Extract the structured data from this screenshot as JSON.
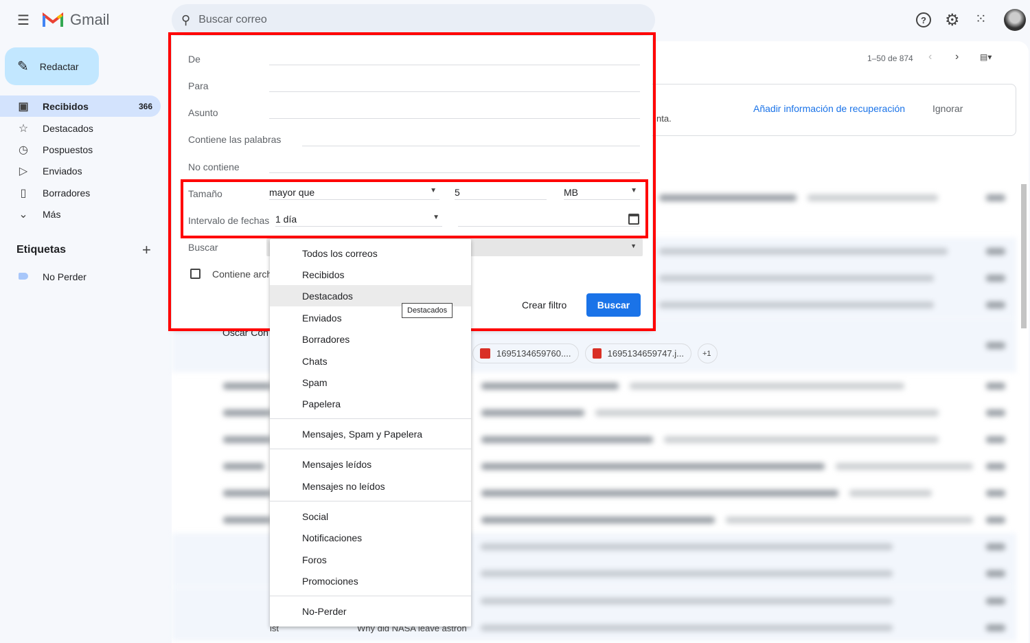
{
  "header": {
    "app_name": "Gmail",
    "search_placeholder": "Buscar correo"
  },
  "sidebar": {
    "compose": "Redactar",
    "items": [
      {
        "label": "Recibidos",
        "count": "366",
        "icon": "inbox-icon"
      },
      {
        "label": "Destacados",
        "icon": "star-icon"
      },
      {
        "label": "Pospuestos",
        "icon": "clock-icon"
      },
      {
        "label": "Enviados",
        "icon": "send-icon"
      },
      {
        "label": "Borradores",
        "icon": "draft-icon"
      },
      {
        "label": "Más",
        "icon": "chevron-down-icon"
      }
    ],
    "labels_title": "Etiquetas",
    "labels": [
      {
        "label": "No Perder",
        "color": "#a8c7fa"
      }
    ]
  },
  "toolbar": {
    "pagination": "1–50 de 874"
  },
  "banner": {
    "text_fragment": "nta.",
    "action": "Añadir información de recuperación",
    "dismiss": "Ignorar"
  },
  "advanced_search": {
    "from": "De",
    "to": "Para",
    "subject": "Asunto",
    "has_words": "Contiene las palabras",
    "doesnt_have": "No contiene",
    "size_label": "Tamaño",
    "size_operator": "mayor que",
    "size_value": "5",
    "size_unit": "MB",
    "date_label": "Intervalo de fechas",
    "date_value": "1 día",
    "search_label": "Buscar",
    "attachment_label": "Contiene arch",
    "create_filter": "Crear filtro",
    "search_button": "Buscar"
  },
  "search_menu": {
    "options": [
      "Todos los correos",
      "Recibidos",
      "Destacados",
      "Enviados",
      "Borradores",
      "Chats",
      "Spam",
      "Papelera",
      "Mensajes, Spam y Papelera",
      "Mensajes leídos",
      "Mensajes no leídos",
      "Social",
      "Notificaciones",
      "Foros",
      "Promociones",
      "No-Perder"
    ],
    "hovered": "Destacados",
    "tooltip": "Destacados"
  },
  "email_list": {
    "visible_sender": "Oscar Con",
    "attachments": [
      "1695134659760....",
      "1695134659747.j...",
      "+1"
    ],
    "bottom_sender_fragment": "ist",
    "bottom_subject": "Why did NASA leave astron"
  },
  "colors": {
    "accent": "#1a73e8",
    "highlight": "#ff0000",
    "active_nav": "#d3e3fd",
    "compose": "#c2e7ff"
  }
}
